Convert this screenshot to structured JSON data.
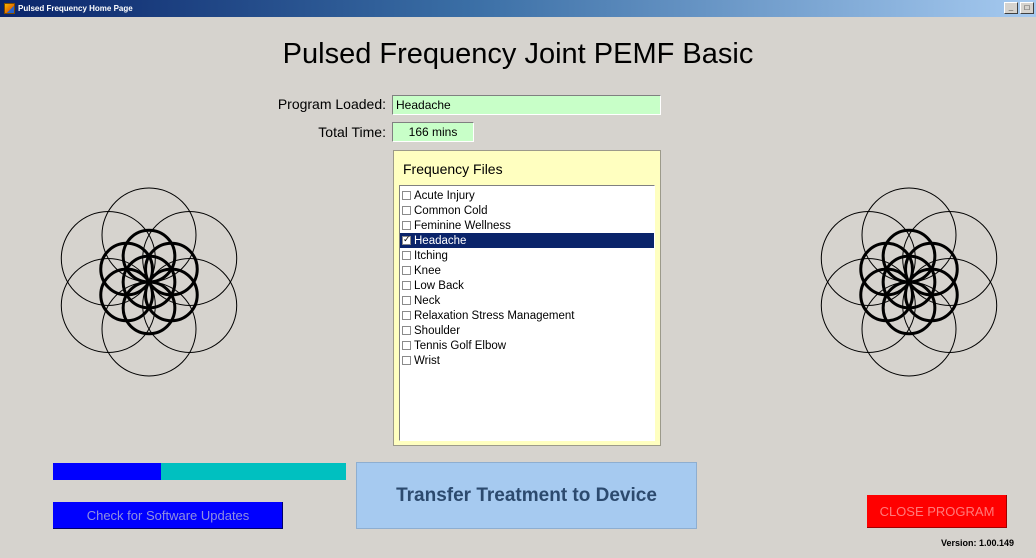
{
  "window": {
    "title": "Pulsed Frequency Home Page",
    "controls": [
      "_",
      "□"
    ]
  },
  "header": {
    "title": "Pulsed Frequency Joint PEMF Basic"
  },
  "program": {
    "loaded_label": "Program Loaded:",
    "loaded_value": "Headache",
    "total_label": "Total Time:",
    "total_value": "166 mins"
  },
  "frequency_files": {
    "title": "Frequency Files",
    "items": [
      {
        "label": "Acute Injury",
        "checked": false,
        "selected": false
      },
      {
        "label": "Common Cold",
        "checked": false,
        "selected": false
      },
      {
        "label": "Feminine Wellness",
        "checked": false,
        "selected": false
      },
      {
        "label": "Headache",
        "checked": true,
        "selected": true
      },
      {
        "label": "Itching",
        "checked": false,
        "selected": false
      },
      {
        "label": "Knee",
        "checked": false,
        "selected": false
      },
      {
        "label": "Low Back",
        "checked": false,
        "selected": false
      },
      {
        "label": "Neck",
        "checked": false,
        "selected": false
      },
      {
        "label": "Relaxation Stress Management",
        "checked": false,
        "selected": false
      },
      {
        "label": "Shoulder",
        "checked": false,
        "selected": false
      },
      {
        "label": "Tennis Golf Elbow",
        "checked": false,
        "selected": false
      },
      {
        "label": "Wrist",
        "checked": false,
        "selected": false
      }
    ]
  },
  "progress": {
    "fraction": 0.37
  },
  "buttons": {
    "update": "Check for Software Updates",
    "transfer": "Transfer Treatment to Device",
    "close": "CLOSE PROGRAM"
  },
  "footer": {
    "version": "Version: 1.00.149"
  },
  "icons": {
    "window_icon": "app-icon",
    "left_flower": "flower-of-life-icon",
    "right_flower": "flower-of-life-icon"
  },
  "colors": {
    "background": "#d6d3ce",
    "field_bg": "#c8ffc8",
    "panel_bg": "#ffffc0",
    "selection": "#0a246a",
    "progress_fill": "#0000ff",
    "progress_track": "#00c0c0",
    "update_button": "#0000ff",
    "transfer_button": "#a6caf0",
    "close_button": "#ff0000"
  }
}
